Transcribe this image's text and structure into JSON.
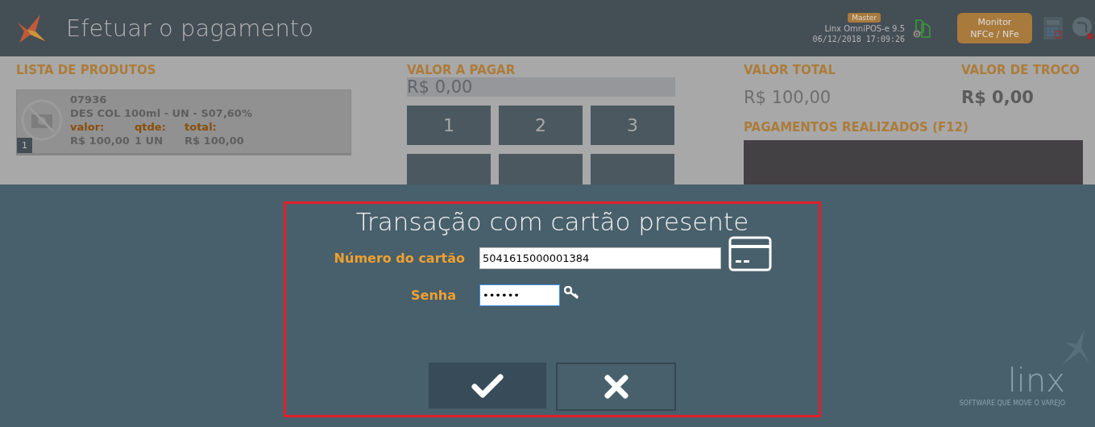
{
  "header": {
    "title": "Efetuar o pagamento",
    "badge": "Master",
    "product": "Linx OmniPOS-e  9.5",
    "datetime": "06/12/2018 17:09:26",
    "pending_count": "0",
    "monitor_button": [
      "Monitor",
      "NFCe / NFe"
    ]
  },
  "products": {
    "heading": "LISTA DE PRODUTOS",
    "items": [
      {
        "index": "1",
        "code": "07936",
        "name": "DES COL 100ml - UN - S07,60%",
        "value_label": "valor:",
        "qty_label": "qtde:",
        "total_label": "total:",
        "value": "R$ 100,00",
        "qty": "1 UN",
        "total": "R$ 100,00"
      }
    ]
  },
  "payment": {
    "heading": "VALOR A PAGAR",
    "amount": "R$ 0,00",
    "keypad": [
      "1",
      "2",
      "3"
    ]
  },
  "totals": {
    "total_heading": "VALOR TOTAL",
    "total": "R$ 100,00",
    "change_heading": "VALOR DE TROCO",
    "change": "R$ 0,00",
    "payments_heading": "PAGAMENTOS REALIZADOS (F12)"
  },
  "dialog": {
    "title": "Transação com cartão presente",
    "fields": [
      {
        "kind": "card",
        "label": "Número do cartão",
        "value": "5041615000001384",
        "focused": false
      },
      {
        "kind": "password",
        "label": "Senha",
        "value": "••••••",
        "focused": true
      }
    ]
  },
  "brand": {
    "name": "linx",
    "tagline": "SOFTWARE QUE MOVE O VAREJO"
  }
}
